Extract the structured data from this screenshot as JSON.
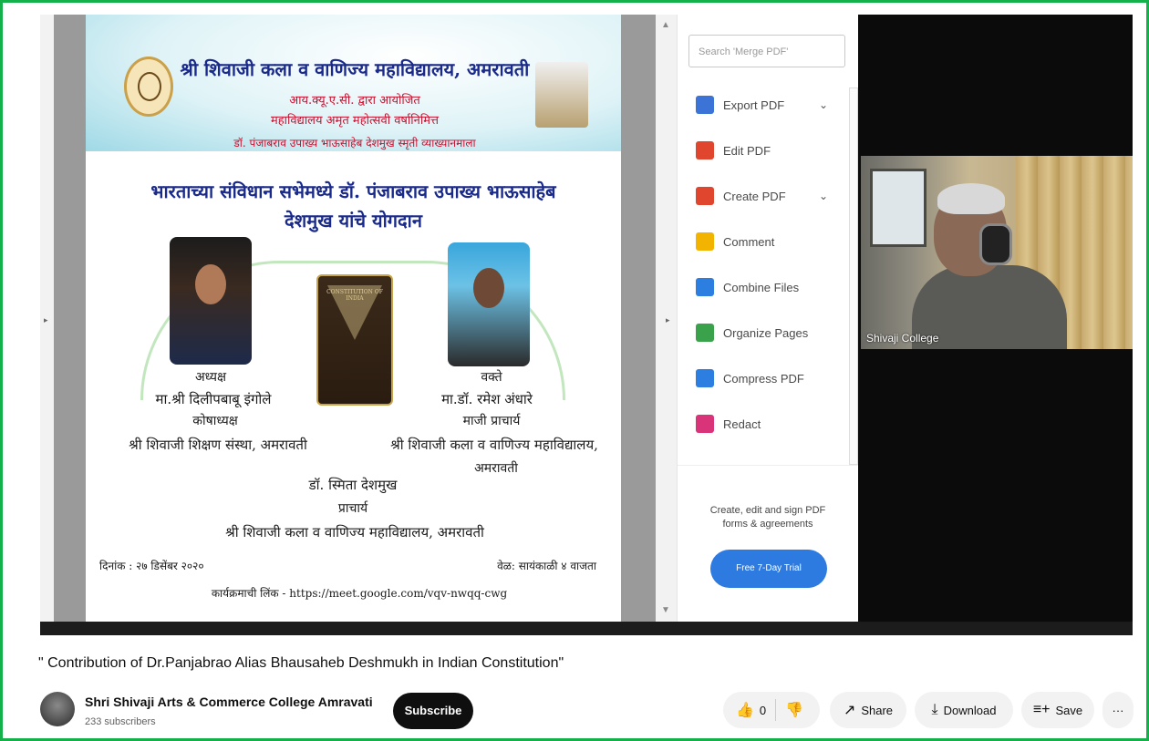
{
  "pdf_viewer": {
    "poster": {
      "header_title": "श्री शिवाजी कला व वाणिज्य महाविद्यालय, अमरावती",
      "line1": "आय.क्यू.ए.सी. द्वारा आयोजित",
      "line2": "महाविद्यालय अमृत महोत्सवी वर्षानिमित्त",
      "line3": "डॉ. पंजाबराव उपाख्य भाऊसाहेब देशमुख स्मृती व्याख्यानमाला",
      "main_title_1": "भारताच्या संविधान सभेमध्ये डॉ. पंजाबराव उपाख्य भाऊसाहेब",
      "main_title_2": "देशमुख यांचे योगदान",
      "left_role": "अध्यक्ष",
      "left_name": "मा.श्री दिलीपबाबू इंगोले",
      "left_post": "कोषाध्यक्ष",
      "left_org": "श्री शिवाजी शिक्षण संस्था, अमरावती",
      "right_role": "वक्ते",
      "right_name": "मा.डॉ. रमेश अंधारे",
      "right_post": "माजी प्राचार्य",
      "right_org_1": "श्री शिवाजी कला व वाणिज्य महाविद्यालय,",
      "right_org_2": "अमरावती",
      "center_name": "डॉ. स्मिता देशमुख",
      "center_post": "प्राचार्य",
      "center_org": "श्री शिवाजी कला व वाणिज्य महाविद्यालय, अमरावती",
      "date": "दिनांक : २७ डिसेंबर २०२०",
      "time": "वेळ: सायंकाळी ४ वाजता",
      "link": "कार्यक्रमाची लिंक - https://meet.google.com/vqv-nwqq-cwg",
      "book_text": "CONSTITUTION OF INDIA"
    },
    "acrobat": {
      "search_placeholder": "Search 'Merge PDF'",
      "tools": [
        {
          "label": "Export PDF",
          "icon": "export-pdf-icon",
          "color": "#3b74d6"
        },
        {
          "label": "Edit PDF",
          "icon": "edit-pdf-icon",
          "color": "#e0452e"
        },
        {
          "label": "Create PDF",
          "icon": "create-pdf-icon",
          "color": "#e0452e"
        },
        {
          "label": "Comment",
          "icon": "comment-icon",
          "color": "#f2b400"
        },
        {
          "label": "Combine Files",
          "icon": "combine-files-icon",
          "color": "#2c7fe0"
        },
        {
          "label": "Organize Pages",
          "icon": "organize-pages-icon",
          "color": "#3aa24a"
        },
        {
          "label": "Compress PDF",
          "icon": "compress-pdf-icon",
          "color": "#2c7fe0"
        },
        {
          "label": "Redact",
          "icon": "redact-icon",
          "color": "#d9347a"
        }
      ],
      "promo_text_1": "Create, edit and sign PDF",
      "promo_text_2": "forms & agreements",
      "trial_button": "Free 7-Day Trial"
    }
  },
  "camera": {
    "participant_label": "Shivaji College"
  },
  "video_info": {
    "title": "\" Contribution of Dr.Panjabrao Alias Bhausaheb Deshmukh in Indian Constitution\"",
    "channel_name": "Shri Shivaji Arts & Commerce College Amravati",
    "subscribers": "233 subscribers",
    "subscribe_label": "Subscribe",
    "like_count": "0",
    "share_label": "Share",
    "download_label": "Download",
    "save_label": "Save",
    "more_label": "···"
  },
  "colors": {
    "frame_border": "#14b14a",
    "poster_title": "#1a2a8a",
    "poster_accent": "#c8102e",
    "trial_button": "#2d7ae0"
  }
}
